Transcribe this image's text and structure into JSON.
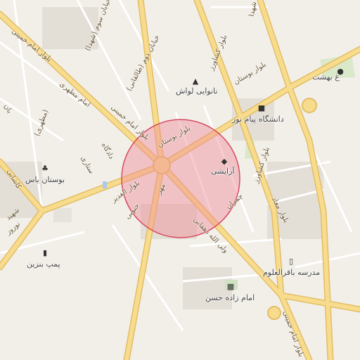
{
  "map": {
    "colors": {
      "background": "#f2efe9",
      "major_road": "#f6d98a",
      "major_road_edge": "#e5bf67",
      "minor_road": "#ffffff",
      "buildings": "#e2ddd6",
      "park": "#d7e6c8",
      "highlight_circle_fill": "#f08b99",
      "highlight_circle_stroke": "#d84a60"
    },
    "pois": [
      {
        "label": "نانوایی لواش",
        "icon": "bakery-icon"
      },
      {
        "label": "دانشگاه پیام نور",
        "icon": "university-icon"
      },
      {
        "label": "آرایشی",
        "icon": "shop-icon"
      },
      {
        "label": "بوستان یاس",
        "icon": "park-tree-icon"
      },
      {
        "label": "پمپ بنزین",
        "icon": "fuel-icon"
      },
      {
        "label": "مدرسه باقرالعلوم",
        "icon": "school-icon"
      },
      {
        "label": "امام زاده حسن",
        "icon": "shrine-icon"
      },
      {
        "label": "غ بهشت",
        "icon": "park-icon"
      }
    ],
    "road_labels": [
      "بلوار بوستان",
      "بلوار بوستان",
      "بلوار کشاورز",
      "بلوار کشاورز",
      "بلوار امام خمینی",
      "بلوار امام خمینی",
      "بلوار الغدیر",
      "بلوار معاد",
      "ولی الله دهقانی",
      "خیابان سوم (شهدا)",
      "خیابان دوم (طالقانی)",
      "امام مطهری",
      "بلوار امام خمینی",
      "(مطهری)",
      "کاشانی",
      "ستاری",
      "دادگاه",
      "مهر",
      "چمران",
      "شهدا",
      "شهید",
      "نوروز",
      "جنوبی",
      "بان"
    ]
  }
}
